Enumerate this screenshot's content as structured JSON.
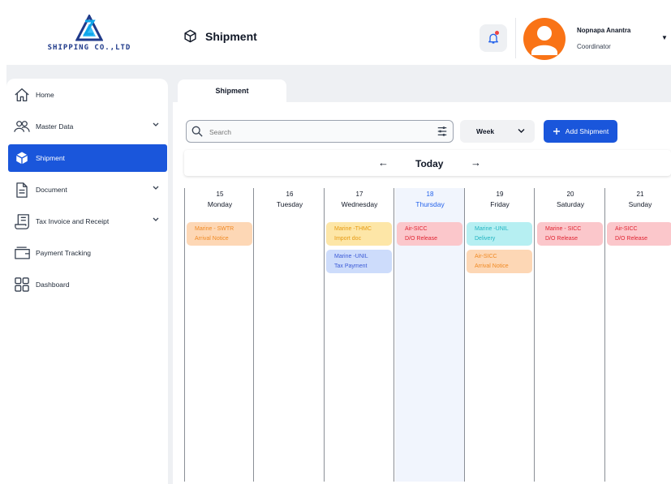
{
  "brand": {
    "logo_text": "SHIPPING CO.,LTD"
  },
  "header": {
    "title": "Shipment",
    "user_name": "Nopnapa Anantra",
    "user_role": "Coordinator"
  },
  "sidebar": {
    "items": [
      {
        "label": "Home",
        "icon": "home-icon",
        "has_chevron": false,
        "active": false
      },
      {
        "label": "Master Data",
        "icon": "users-icon",
        "has_chevron": true,
        "active": false
      },
      {
        "label": "Shipment",
        "icon": "box-icon",
        "has_chevron": false,
        "active": true
      },
      {
        "label": "Document",
        "icon": "document-icon",
        "has_chevron": true,
        "active": false
      },
      {
        "label": "Tax Invoice and Receipt",
        "icon": "receipt-icon",
        "has_chevron": true,
        "active": false
      },
      {
        "label": "Payment Tracking",
        "icon": "wallet-icon",
        "has_chevron": false,
        "active": false
      },
      {
        "label": "Dashboard",
        "icon": "dashboard-icon",
        "has_chevron": false,
        "active": false
      }
    ]
  },
  "tab": {
    "label": "Shipment"
  },
  "toolbar": {
    "search_placeholder": "Search",
    "view_select": "Week",
    "add_label": "Add Shipment"
  },
  "week_nav": {
    "today_label": "Today"
  },
  "colors": {
    "primary": "#1a56db",
    "avatar": "#f97316",
    "today_text": "#2563eb"
  },
  "calendar": {
    "days": [
      {
        "num": "15",
        "name": "Monday",
        "events": [
          {
            "line1": "Marine - SWTR",
            "line2": "Arrival Notice",
            "color": "orange"
          }
        ]
      },
      {
        "num": "16",
        "name": "Tuesday",
        "events": []
      },
      {
        "num": "17",
        "name": "Wednesday",
        "events": [
          {
            "line1": "Marine -THMC",
            "line2": "Import doc",
            "color": "yellow"
          },
          {
            "line1": "Marine -UNIL",
            "line2": "Tax Payment",
            "color": "blue"
          }
        ]
      },
      {
        "num": "18",
        "name": "Thursday",
        "today": true,
        "events": [
          {
            "line1": "Air-SICC",
            "line2": "D/O Release",
            "color": "red"
          }
        ]
      },
      {
        "num": "19",
        "name": "Friday",
        "events": [
          {
            "line1": "Marine -UNIL",
            "line2": "Delivery",
            "color": "cyan"
          },
          {
            "line1": "Air-SICC",
            "line2": "Arrival Notice",
            "color": "orange"
          }
        ]
      },
      {
        "num": "20",
        "name": "Saturday",
        "events": [
          {
            "line1": "Marine - SICC",
            "line2": "D/O Release",
            "color": "red"
          }
        ]
      },
      {
        "num": "21",
        "name": "Sunday",
        "events": [
          {
            "line1": "Air-SICC",
            "line2": "D/O Release",
            "color": "red"
          }
        ]
      }
    ]
  }
}
